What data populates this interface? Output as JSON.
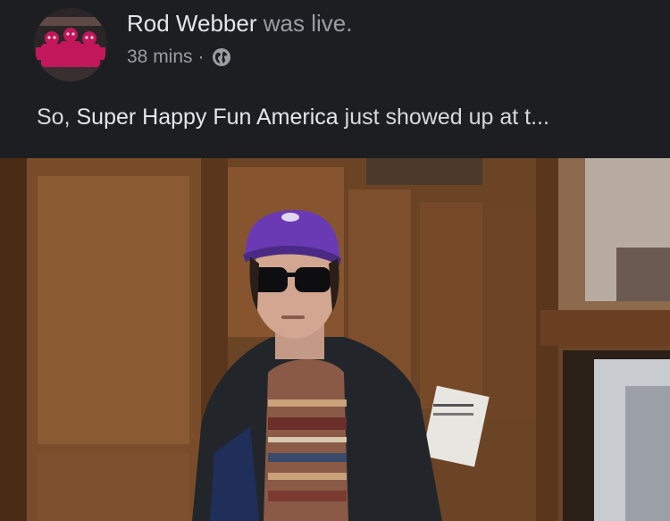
{
  "post": {
    "author": "Rod Webber",
    "status": "was live.",
    "time": "38 mins",
    "separator": "·",
    "privacy_icon": "globe-icon",
    "text_prefix": "So,",
    "text_link": "Super Happy Fun America",
    "text_suffix": "just showed up at t..."
  },
  "colors": {
    "background": "#1c1e21",
    "primary_text": "#e4e6eb",
    "secondary_text": "#9a9da2",
    "avatar_accent": "#c2185b"
  }
}
